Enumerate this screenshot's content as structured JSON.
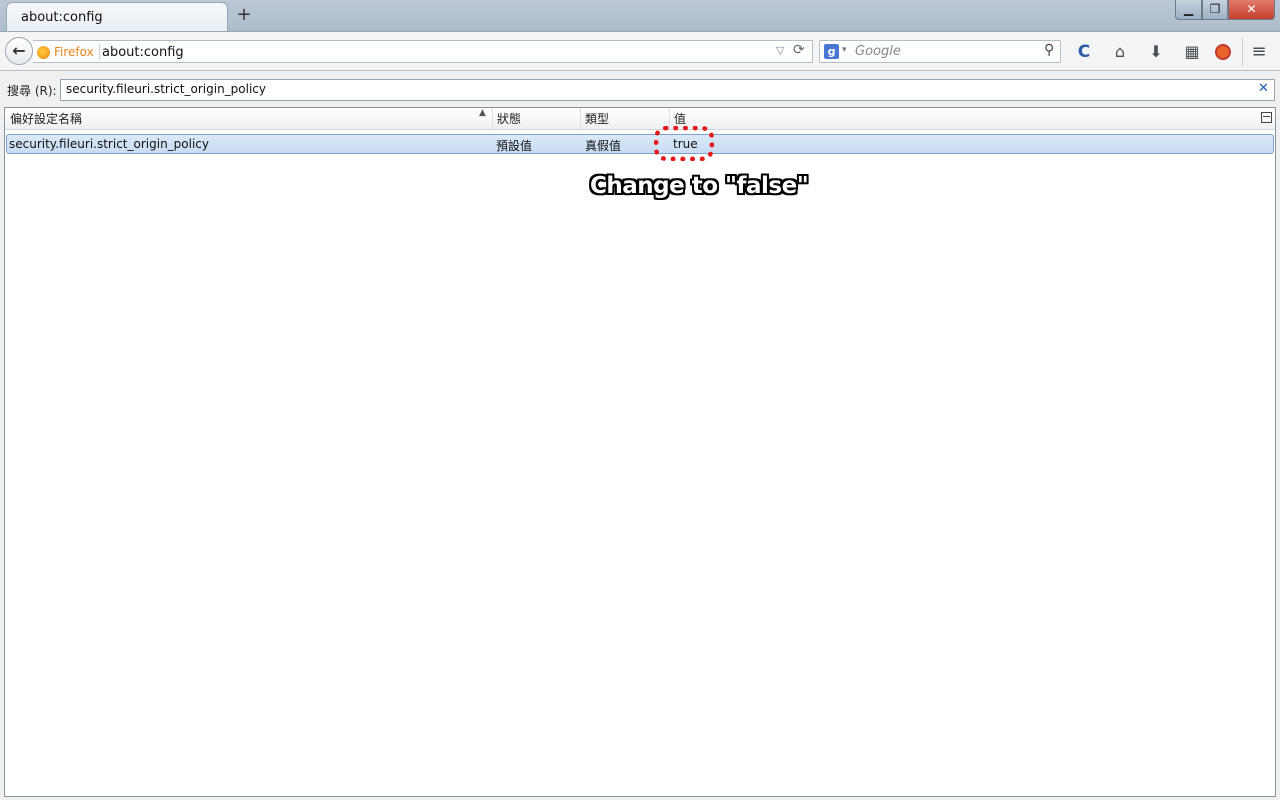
{
  "window": {
    "tab_title": "about:config",
    "new_tab_label": "+",
    "minimize_label": "▁",
    "maximize_label": "❐",
    "close_label": "✕"
  },
  "toolbar": {
    "back_label": "←",
    "identity_label": "Firefox",
    "url": "about:config",
    "url_dropdown_label": "▽",
    "reload_label": "⟳",
    "search_engine_letter": "g",
    "search_caret": "▾",
    "search_placeholder": "Google",
    "search_go_label": "⚲",
    "addon_c_label": "C",
    "home_label": "⌂",
    "download_label": "⬇",
    "apps_label": "▦",
    "menu_label": "≡"
  },
  "filter": {
    "label": "搜尋 (R):",
    "value": "security.fileuri.strict_origin_policy",
    "clear_label": "✕"
  },
  "columns": {
    "name": "偏好設定名稱",
    "status": "狀態",
    "type": "類型",
    "value": "值",
    "sort_indicator": "▲"
  },
  "rows": [
    {
      "name": "security.fileuri.strict_origin_policy",
      "status": "預設值",
      "type": "真假值",
      "value": "true"
    }
  ],
  "annotation": {
    "text": "Change to \"false\"",
    "highlight_color": "#e41818"
  },
  "colors": {
    "accent": "#1a5fb4",
    "firefox_orange": "#e8851b",
    "row_selected": "#c9dcf2"
  }
}
